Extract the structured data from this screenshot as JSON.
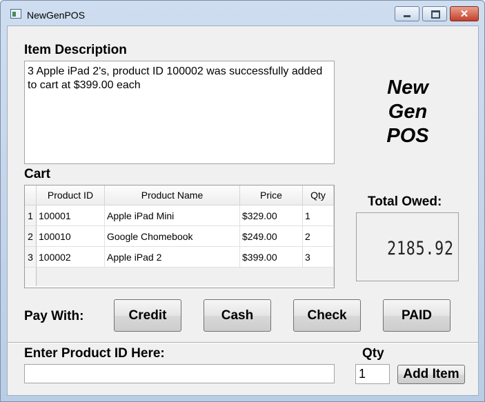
{
  "window": {
    "title": "NewGenPOS",
    "close_glyph": "✕"
  },
  "item_description": {
    "label": "Item Description",
    "text": "3 Apple iPad 2's, product ID 100002 was successfully added to cart at $399.00 each"
  },
  "logo": {
    "line1": "New",
    "line2": "Gen",
    "line3": "POS"
  },
  "cart": {
    "label": "Cart",
    "columns": [
      "Product ID",
      "Product Name",
      "Price",
      "Qty"
    ],
    "rows": [
      {
        "row_num": "1",
        "product_id": "100001",
        "product_name": "Apple iPad Mini",
        "price": "$329.00",
        "qty": "1"
      },
      {
        "row_num": "2",
        "product_id": "100010",
        "product_name": "Google Chomebook",
        "price": "$249.00",
        "qty": "2"
      },
      {
        "row_num": "3",
        "product_id": "100002",
        "product_name": "Apple iPad 2",
        "price": "$399.00",
        "qty": "3"
      }
    ]
  },
  "total": {
    "label": "Total Owed:",
    "value": "2185.92"
  },
  "payment": {
    "label": "Pay With:",
    "credit": "Credit",
    "cash": "Cash",
    "check": "Check",
    "paid": "PAID"
  },
  "entry": {
    "product_id_label": "Enter Product ID Here:",
    "product_id_value": "",
    "qty_label": "Qty",
    "qty_value": "1",
    "add_button": "Add Item"
  }
}
